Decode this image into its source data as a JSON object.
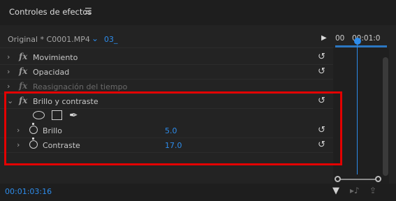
{
  "header": {
    "title": "Controles de efectos",
    "menu_icon": "☰"
  },
  "source": {
    "clip": "Original * C0001.MP4",
    "chevron": "⌄",
    "sequence": "03_",
    "play_icon": "▶"
  },
  "timeline": {
    "tc_start": "00",
    "tc_end": "00:01:0",
    "accent": "#2d8ceb"
  },
  "effects": [
    {
      "expander": "›",
      "fx": "fx",
      "label": "Movimiento",
      "reset": "↺"
    },
    {
      "expander": "›",
      "fx": "fx",
      "label": "Opacidad",
      "reset": "↺"
    },
    {
      "expander": "›",
      "fx": "fx",
      "label": "Reasignación del tiempo"
    },
    {
      "expander": "⌄",
      "fx": "fx",
      "label": "Brillo y contraste",
      "reset": "↺"
    }
  ],
  "properties": [
    {
      "expander": "›",
      "label": "Brillo",
      "value": "5.0",
      "reset": "↺"
    },
    {
      "expander": "›",
      "label": "Contraste",
      "value": "17.0",
      "reset": "↺"
    }
  ],
  "mask_tools": {
    "ellipse": "ellipse-mask-icon",
    "rect": "rectangle-mask-icon",
    "pen": "✒"
  },
  "footer": {
    "timecode": "00:01:03:16",
    "filter_icon": "▼",
    "icon2": "▸♪",
    "icon3": "⇪"
  },
  "colors": {
    "highlight": "#e30000",
    "accent": "#2d8ceb"
  }
}
